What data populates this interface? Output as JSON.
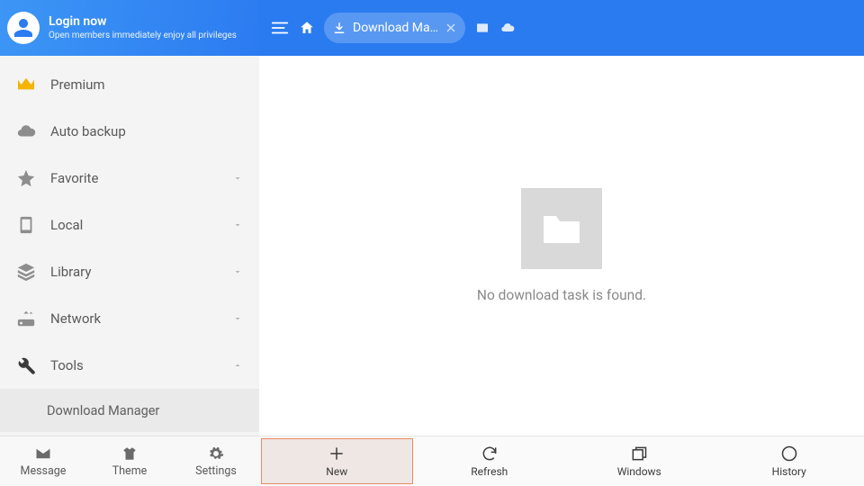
{
  "login": {
    "title": "Login now",
    "subtitle": "Open members immediately enjoy all privileges"
  },
  "nav": {
    "premium": "Premium",
    "autobackup": "Auto backup",
    "favorite": "Favorite",
    "local": "Local",
    "library": "Library",
    "network": "Network",
    "tools": "Tools",
    "tools_children": {
      "download_manager": "Download Manager"
    }
  },
  "sidebar_bottom": {
    "message": "Message",
    "theme": "Theme",
    "settings": "Settings"
  },
  "tab": {
    "label": "Download Ma…"
  },
  "empty": {
    "message": "No download task is found."
  },
  "main_bottom": {
    "new": "New",
    "refresh": "Refresh",
    "windows": "Windows",
    "history": "History"
  }
}
